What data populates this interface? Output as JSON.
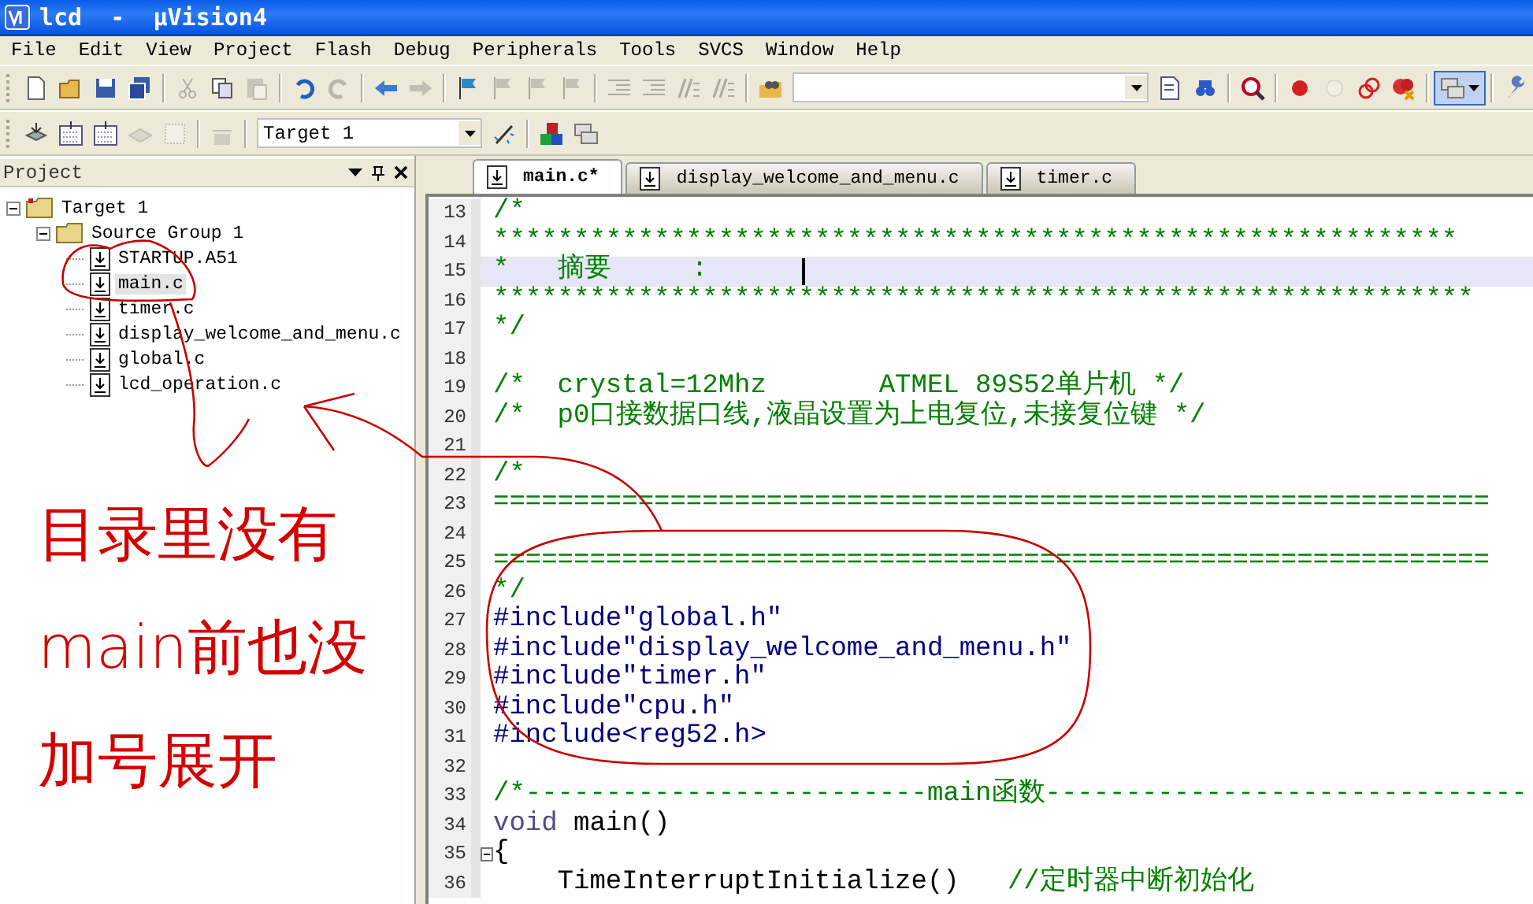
{
  "window": {
    "title": "lcd  -  µVision4"
  },
  "menu": [
    {
      "label": "File"
    },
    {
      "label": "Edit"
    },
    {
      "label": "View"
    },
    {
      "label": "Project"
    },
    {
      "label": "Flash"
    },
    {
      "label": "Debug"
    },
    {
      "label": "Peripherals"
    },
    {
      "label": "Tools"
    },
    {
      "label": "SVCS"
    },
    {
      "label": "Window"
    },
    {
      "label": "Help"
    }
  ],
  "toolbar_1": {
    "buttons": [
      {
        "disabled": false
      },
      {
        "disabled": false
      },
      {
        "disabled": false
      },
      {
        "disabled": false
      },
      {
        "disabled": true
      },
      {
        "disabled": false
      },
      {
        "disabled": true
      },
      {
        "disabled": false
      },
      {
        "disabled": true
      },
      {
        "disabled": false
      },
      {
        "disabled": true
      },
      {
        "disabled": false
      },
      {
        "disabled": true
      },
      {
        "disabled": true
      },
      {
        "disabled": true
      },
      {
        "disabled": true
      },
      {
        "disabled": true
      },
      {
        "disabled": true
      },
      {
        "disabled": true
      },
      {
        "disabled": false
      },
      {
        "disabled": false
      },
      {
        "disabled": false
      },
      {
        "disabled": false
      },
      {
        "disabled": false
      },
      {
        "disabled": true
      },
      {
        "disabled": false
      },
      {
        "disabled": false
      },
      {
        "disabled": false
      },
      {
        "disabled": false
      }
    ]
  },
  "toolbar_2": {
    "target": "Target 1",
    "buttons": [
      {
        "disabled": false
      },
      {
        "disabled": false
      },
      {
        "disabled": false
      },
      {
        "disabled": true
      },
      {
        "disabled": true
      },
      {
        "disabled": true
      },
      {
        "disabled": false
      },
      {
        "disabled": false
      },
      {
        "disabled": false
      }
    ]
  },
  "project_panel": {
    "title": "Project",
    "tree": [
      {
        "label": "Target 1",
        "kind": "target",
        "expanded": true,
        "selected": false,
        "children": [
          {
            "label": "Source Group 1",
            "kind": "group",
            "expanded": true,
            "selected": false,
            "children": [
              {
                "label": "STARTUP.A51",
                "kind": "file",
                "selected": false
              },
              {
                "label": "main.c",
                "kind": "file",
                "selected": true
              },
              {
                "label": "timer.c",
                "kind": "file",
                "selected": false
              },
              {
                "label": "display_welcome_and_menu.c",
                "kind": "file",
                "selected": false
              },
              {
                "label": "global.c",
                "kind": "file",
                "selected": false
              },
              {
                "label": "lcd_operation.c",
                "kind": "file",
                "selected": false
              }
            ]
          }
        ]
      }
    ]
  },
  "annotation": {
    "lines": [
      "目录里没有",
      "main前也没",
      "加号展开"
    ]
  },
  "tabs": [
    {
      "label": "main.c*",
      "selected": true
    },
    {
      "label": "display_welcome_and_menu.c",
      "selected": false
    },
    {
      "label": "timer.c",
      "selected": false
    }
  ],
  "editor": {
    "lines": [
      {
        "number": "13",
        "highlighted": false,
        "fold_marker": false,
        "segments": [
          {
            "kind": "comment",
            "text": "/*"
          }
        ]
      },
      {
        "number": "14",
        "highlighted": false,
        "fold_marker": false,
        "segments": [
          {
            "kind": "comment",
            "text": "************************************************************"
          }
        ]
      },
      {
        "number": "15",
        "highlighted": true,
        "fold_marker": false,
        "segments": [
          {
            "kind": "comment",
            "text": "*   摘要     :"
          }
        ]
      },
      {
        "number": "16",
        "highlighted": false,
        "fold_marker": false,
        "segments": [
          {
            "kind": "comment",
            "text": "*************************************************************"
          }
        ]
      },
      {
        "number": "17",
        "highlighted": false,
        "fold_marker": false,
        "segments": [
          {
            "kind": "comment",
            "text": "*/"
          }
        ]
      },
      {
        "number": "18",
        "highlighted": false,
        "fold_marker": false
      },
      {
        "number": "19",
        "highlighted": false,
        "fold_marker": false,
        "segments": [
          {
            "kind": "comment",
            "text": "/*  crystal=12Mhz       ATMEL 89S52单片机 */"
          }
        ]
      },
      {
        "number": "20",
        "highlighted": false,
        "fold_marker": false,
        "segments": [
          {
            "kind": "comment",
            "text": "/*  p0口接数据口线,液晶设置为上电复位,未接复位键 */"
          }
        ]
      },
      {
        "number": "21",
        "highlighted": false,
        "fold_marker": false
      },
      {
        "number": "22",
        "highlighted": false,
        "fold_marker": false,
        "segments": [
          {
            "kind": "comment",
            "text": "/*"
          }
        ]
      },
      {
        "number": "23",
        "highlighted": false,
        "fold_marker": false,
        "segments": [
          {
            "kind": "comment",
            "text": "=============================================================="
          }
        ]
      },
      {
        "number": "24",
        "highlighted": false,
        "fold_marker": false
      },
      {
        "number": "25",
        "highlighted": false,
        "fold_marker": false,
        "segments": [
          {
            "kind": "comment",
            "text": "=============================================================="
          }
        ]
      },
      {
        "number": "26",
        "highlighted": false,
        "fold_marker": false,
        "segments": [
          {
            "kind": "comment",
            "text": "*/"
          }
        ]
      },
      {
        "number": "27",
        "highlighted": false,
        "fold_marker": false,
        "segments": [
          {
            "kind": "directive",
            "text": "#include\"global.h\""
          }
        ]
      },
      {
        "number": "28",
        "highlighted": false,
        "fold_marker": false,
        "segments": [
          {
            "kind": "directive",
            "text": "#include\"display_welcome_and_menu.h\""
          }
        ]
      },
      {
        "number": "29",
        "highlighted": false,
        "fold_marker": false,
        "segments": [
          {
            "kind": "directive",
            "text": "#include\"timer.h\""
          }
        ]
      },
      {
        "number": "30",
        "highlighted": false,
        "fold_marker": false,
        "segments": [
          {
            "kind": "directive",
            "text": "#include\"cpu.h\""
          }
        ]
      },
      {
        "number": "31",
        "highlighted": false,
        "fold_marker": false,
        "segments": [
          {
            "kind": "directive",
            "text": "#include<reg52.h>"
          }
        ]
      },
      {
        "number": "32",
        "highlighted": false,
        "fold_marker": false
      },
      {
        "number": "33",
        "highlighted": false,
        "fold_marker": false,
        "segments": [
          {
            "kind": "comment",
            "text": "/*-------------------------main函数------------------------------"
          }
        ]
      },
      {
        "number": "34",
        "highlighted": false,
        "fold_marker": false,
        "segments": [
          {
            "kind": "keyword",
            "text": "void"
          },
          {
            "kind": "plain",
            "text": " main()"
          }
        ]
      },
      {
        "number": "35",
        "highlighted": false,
        "fold_marker": true,
        "segments": [
          {
            "kind": "plain",
            "text": "{"
          }
        ]
      },
      {
        "number": "36",
        "highlighted": false,
        "fold_marker": false,
        "segments": [
          {
            "kind": "plain",
            "text": "    TimeInterruptInitialize()"
          },
          {
            "kind": "comment",
            "text": "   //定时器中断初始化"
          }
        ]
      }
    ]
  }
}
